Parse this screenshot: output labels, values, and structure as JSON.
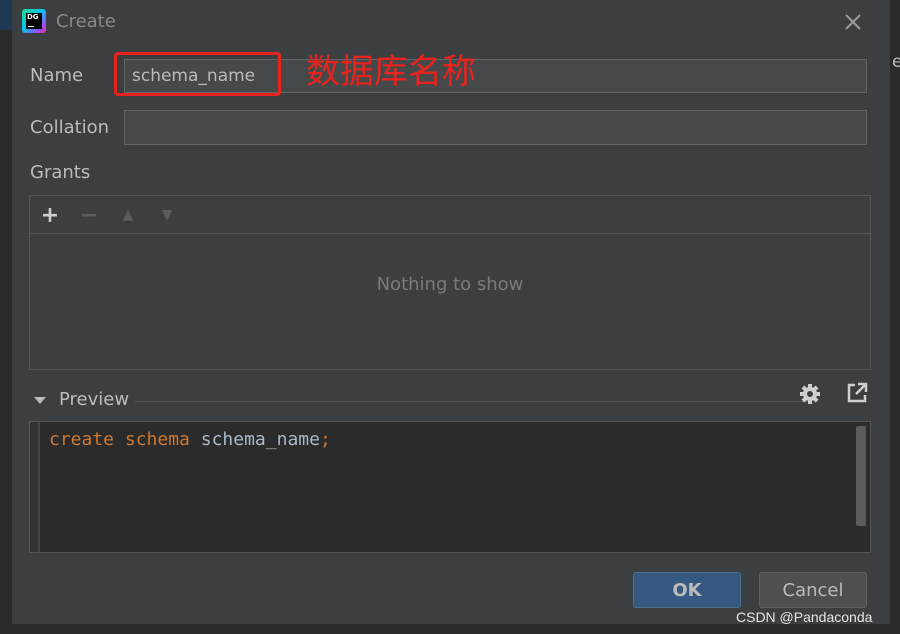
{
  "window": {
    "title": "Create",
    "app_icon_text": "DG"
  },
  "form": {
    "name_label": "Name",
    "name_value": "schema_name",
    "collation_label": "Collation",
    "collation_value": "",
    "grants_label": "Grants"
  },
  "annotation": {
    "text": "数据库名称",
    "color": "#e8231e"
  },
  "grants": {
    "toolbar": {
      "add": "+",
      "remove": "−",
      "up": "▲",
      "down": "▼"
    },
    "empty_text": "Nothing to show"
  },
  "preview": {
    "label": "Preview",
    "code": {
      "keyword1": "create",
      "keyword2": "schema",
      "identifier": "schema_name",
      "terminator": ";"
    }
  },
  "buttons": {
    "ok": "OK",
    "cancel": "Cancel"
  },
  "watermark": "CSDN @Pandaconda",
  "colors": {
    "dialog_bg": "#3c3f41",
    "field_bg": "#45494a",
    "ok_bg": "#365880",
    "keyword": "#cc7832",
    "identifier": "#a9b7c6"
  }
}
